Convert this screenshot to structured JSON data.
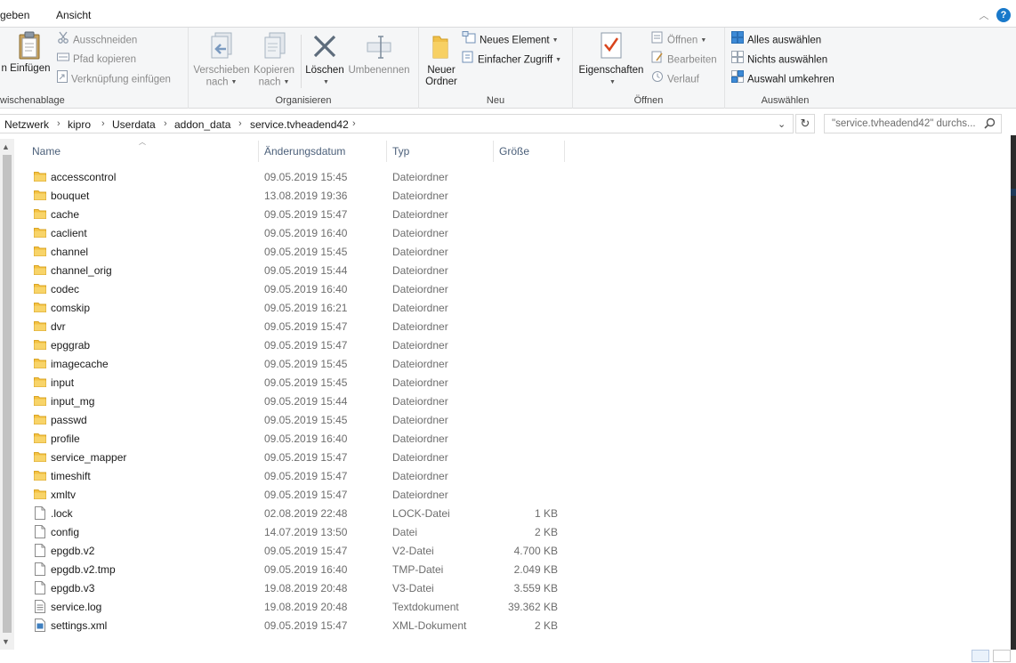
{
  "tabs": [
    {
      "label": "geben"
    },
    {
      "label": "Ansicht"
    }
  ],
  "help_label": "?",
  "ribbon": {
    "clipboard": {
      "group_label": "wischenablage",
      "paste_label": "n Einfügen",
      "cut_label": "Ausschneiden",
      "copy_path_label": "Pfad kopieren",
      "paste_shortcut_label": "Verknüpfung einfügen"
    },
    "organize": {
      "group_label": "Organisieren",
      "move_label_1": "Verschieben",
      "move_label_2": "nach",
      "copy_label_1": "Kopieren",
      "copy_label_2": "nach",
      "delete_label": "Löschen",
      "rename_label": "Umbenennen"
    },
    "new": {
      "group_label": "Neu",
      "new_folder_label_1": "Neuer",
      "new_folder_label_2": "Ordner",
      "new_item_label": "Neues Element",
      "easy_access_label": "Einfacher Zugriff"
    },
    "open": {
      "group_label": "Öffnen",
      "properties_label": "Eigenschaften",
      "open_label": "Öffnen",
      "edit_label": "Bearbeiten",
      "history_label": "Verlauf"
    },
    "select": {
      "group_label": "Auswählen",
      "select_all_label": "Alles auswählen",
      "select_none_label": "Nichts auswählen",
      "invert_label": "Auswahl umkehren"
    }
  },
  "address": {
    "crumbs": [
      "Netzwerk",
      "kipro",
      "Userdata",
      "addon_data",
      "service.tvheadend42"
    ],
    "search_placeholder": "\"service.tvheadend42\" durchs..."
  },
  "columns": {
    "name": "Name",
    "date": "Änderungsdatum",
    "type": "Typ",
    "size": "Größe"
  },
  "files": [
    {
      "name": "accesscontrol",
      "date": "09.05.2019 15:45",
      "type": "Dateiordner",
      "size": "",
      "kind": "folder"
    },
    {
      "name": "bouquet",
      "date": "13.08.2019 19:36",
      "type": "Dateiordner",
      "size": "",
      "kind": "folder"
    },
    {
      "name": "cache",
      "date": "09.05.2019 15:47",
      "type": "Dateiordner",
      "size": "",
      "kind": "folder"
    },
    {
      "name": "caclient",
      "date": "09.05.2019 16:40",
      "type": "Dateiordner",
      "size": "",
      "kind": "folder"
    },
    {
      "name": "channel",
      "date": "09.05.2019 15:45",
      "type": "Dateiordner",
      "size": "",
      "kind": "folder"
    },
    {
      "name": "channel_orig",
      "date": "09.05.2019 15:44",
      "type": "Dateiordner",
      "size": "",
      "kind": "folder"
    },
    {
      "name": "codec",
      "date": "09.05.2019 16:40",
      "type": "Dateiordner",
      "size": "",
      "kind": "folder"
    },
    {
      "name": "comskip",
      "date": "09.05.2019 16:21",
      "type": "Dateiordner",
      "size": "",
      "kind": "folder"
    },
    {
      "name": "dvr",
      "date": "09.05.2019 15:47",
      "type": "Dateiordner",
      "size": "",
      "kind": "folder"
    },
    {
      "name": "epggrab",
      "date": "09.05.2019 15:47",
      "type": "Dateiordner",
      "size": "",
      "kind": "folder"
    },
    {
      "name": "imagecache",
      "date": "09.05.2019 15:45",
      "type": "Dateiordner",
      "size": "",
      "kind": "folder"
    },
    {
      "name": "input",
      "date": "09.05.2019 15:45",
      "type": "Dateiordner",
      "size": "",
      "kind": "folder"
    },
    {
      "name": "input_mg",
      "date": "09.05.2019 15:44",
      "type": "Dateiordner",
      "size": "",
      "kind": "folder"
    },
    {
      "name": "passwd",
      "date": "09.05.2019 15:45",
      "type": "Dateiordner",
      "size": "",
      "kind": "folder"
    },
    {
      "name": "profile",
      "date": "09.05.2019 16:40",
      "type": "Dateiordner",
      "size": "",
      "kind": "folder"
    },
    {
      "name": "service_mapper",
      "date": "09.05.2019 15:47",
      "type": "Dateiordner",
      "size": "",
      "kind": "folder"
    },
    {
      "name": "timeshift",
      "date": "09.05.2019 15:47",
      "type": "Dateiordner",
      "size": "",
      "kind": "folder"
    },
    {
      "name": "xmltv",
      "date": "09.05.2019 15:47",
      "type": "Dateiordner",
      "size": "",
      "kind": "folder"
    },
    {
      "name": ".lock",
      "date": "02.08.2019 22:48",
      "type": "LOCK-Datei",
      "size": "1 KB",
      "kind": "file"
    },
    {
      "name": "config",
      "date": "14.07.2019 13:50",
      "type": "Datei",
      "size": "2 KB",
      "kind": "file"
    },
    {
      "name": "epgdb.v2",
      "date": "09.05.2019 15:47",
      "type": "V2-Datei",
      "size": "4.700 KB",
      "kind": "file"
    },
    {
      "name": "epgdb.v2.tmp",
      "date": "09.05.2019 16:40",
      "type": "TMP-Datei",
      "size": "2.049 KB",
      "kind": "file"
    },
    {
      "name": "epgdb.v3",
      "date": "19.08.2019 20:48",
      "type": "V3-Datei",
      "size": "3.559 KB",
      "kind": "file"
    },
    {
      "name": "service.log",
      "date": "19.08.2019 20:48",
      "type": "Textdokument",
      "size": "39.362 KB",
      "kind": "text"
    },
    {
      "name": "settings.xml",
      "date": "09.05.2019 15:47",
      "type": "XML-Dokument",
      "size": "2 KB",
      "kind": "xml"
    }
  ],
  "colors": {
    "folder": "#f5c242",
    "accent": "#1979ca",
    "header_text": "#4c607a"
  }
}
